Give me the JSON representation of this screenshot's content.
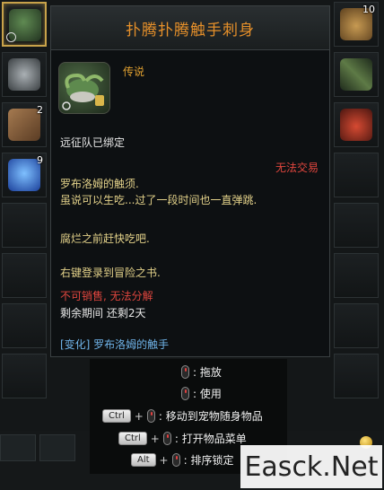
{
  "inventory": {
    "left_slots": [
      {
        "name": "tentacle-item-icon",
        "qty": ""
      },
      {
        "name": "ore-item-icon",
        "qty": ""
      },
      {
        "name": "sack-item-icon",
        "qty": "2"
      },
      {
        "name": "crystal-item-icon",
        "qty": "9"
      }
    ],
    "right_slots": [
      {
        "name": "bag-item-icon",
        "qty": "10"
      },
      {
        "name": "branch-item-icon",
        "qty": ""
      },
      {
        "name": "crab-item-icon",
        "qty": ""
      }
    ]
  },
  "tooltip": {
    "title": "扑腾扑腾触手刺身",
    "rarity": "传说",
    "bound": "远征队已绑定",
    "trade": "无法交易",
    "desc_line1": "罗布洛姆的触须.",
    "desc_line2": "虽说可以生吃...过了一段时间也一直弹跳.",
    "desc_line3": "腐烂之前赶快吃吧.",
    "register": "右键登录到冒险之书.",
    "restriction": "不可销售, 无法分解",
    "remaining": "剩余期间 还剩2天",
    "transform": "[变化] 罗布洛姆的触手"
  },
  "hints": {
    "drag": ": 拖放",
    "use": ": 使用",
    "ctrl_key": "Ctrl",
    "move_pet": ": 移动到宠物随身物品",
    "open_menu": ": 打开物品菜单",
    "alt_key": "Alt",
    "sort_lock": ": 排序锁定"
  },
  "watermark": "Easck.Net",
  "colors": {
    "title": "#e6902a",
    "rarity": "#e0a030",
    "description": "#e4d28a",
    "warning": "#e0463e",
    "transform": "#6fb3e8"
  }
}
